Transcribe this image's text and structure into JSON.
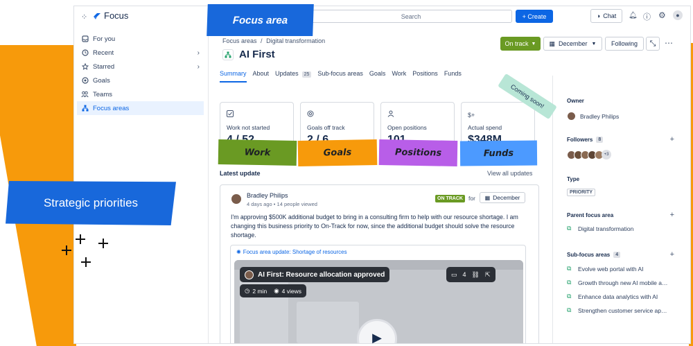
{
  "app": {
    "name": "Focus",
    "search_placeholder": "Search",
    "create_label": "+ Create",
    "chat_label": "Chat"
  },
  "sidebar": {
    "items": [
      {
        "label": "For you",
        "icon": "inbox-icon"
      },
      {
        "label": "Recent",
        "icon": "clock-icon"
      },
      {
        "label": "Starred",
        "icon": "star-icon"
      },
      {
        "label": "Goals",
        "icon": "goal-icon"
      },
      {
        "label": "Teams",
        "icon": "people-icon"
      },
      {
        "label": "Focus areas",
        "icon": "hierarchy-icon"
      }
    ]
  },
  "callouts": {
    "focus_area": "Focus area",
    "strategic": "Strategic priorities",
    "coming_soon": "Coming soon!"
  },
  "breadcrumb": {
    "root": "Focus areas",
    "sep": "/",
    "current": "Digital transformation"
  },
  "page": {
    "title": "AI First",
    "status": "On track",
    "month": "December",
    "follow": "Following"
  },
  "tabs": [
    {
      "label": "Summary"
    },
    {
      "label": "About"
    },
    {
      "label": "Updates",
      "count": "25"
    },
    {
      "label": "Sub-focus areas"
    },
    {
      "label": "Goals"
    },
    {
      "label": "Work"
    },
    {
      "label": "Positions"
    },
    {
      "label": "Funds"
    }
  ],
  "metrics": [
    {
      "label": "Work not started",
      "value": "4 / 52",
      "tag": "Work",
      "color": "#6a9a23"
    },
    {
      "label": "Goals off track",
      "value": "2 / 6",
      "tag": "Goals",
      "color": "#f79a0b"
    },
    {
      "label": "Open positions",
      "value": "101",
      "tag": "Positions",
      "color": "#b85ee8"
    },
    {
      "label": "Actual spend",
      "value": "$348M",
      "tag": "Funds",
      "color": "#4c9aff"
    }
  ],
  "update": {
    "section_title": "Latest update",
    "view_all": "View all updates",
    "author": "Bradley Philips",
    "meta_ago": "4 days ago",
    "meta_sep": "•",
    "meta_views": "14 people viewed",
    "status": "ON TRACK",
    "for": "for",
    "month": "December",
    "body": "I'm approving $500K additional budget to bring in a consulting firm to help with our resource shortage. I am changing this business priority to On-Track for now, since the additional budget should solve the resource shortage.",
    "link": "Focus area update: Shortage of resources",
    "video": {
      "title": "AI First: Resource allocation approved",
      "comments": "4",
      "duration": "2 min",
      "views": "4 views"
    }
  },
  "right": {
    "owner_label": "Owner",
    "owner": "Bradley Philips",
    "followers_label": "Followers",
    "followers_count": "8",
    "followers_extra": "+3",
    "type_label": "Type",
    "type": "PRIORITY",
    "parent_label": "Parent focus area",
    "parent": "Digital transformation",
    "sub_label": "Sub-focus areas",
    "sub_count": "4",
    "subs": [
      "Evolve web portal with AI",
      "Growth through new AI mobile a…",
      "Enhance data analytics with AI",
      "Strengthen customer service ap…"
    ]
  }
}
